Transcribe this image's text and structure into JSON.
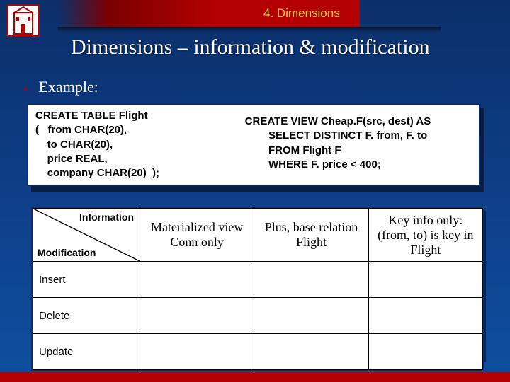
{
  "header": {
    "breadcrumb": "4. Dimensions",
    "title": "Dimensions – information & modification"
  },
  "bullet": {
    "marker": "➢",
    "label": "Example:"
  },
  "code": {
    "left": "CREATE TABLE Flight\n(   from CHAR(20),\n    to CHAR(20),\n    price REAL,\n    company CHAR(20)  );",
    "right": "CREATE VIEW Cheap.F(src, dest) AS\n        SELECT DISTINCT F. from, F. to\n        FROM Flight F\n        WHERE F. price < 400;"
  },
  "table": {
    "diag": {
      "info": "Information",
      "mod": "Modification"
    },
    "cols": [
      "Materialized view Conn only",
      "Plus, base relation Flight",
      "Key info only: (from, to) is key in Flight"
    ],
    "rows": [
      "Insert",
      "Delete",
      "Update"
    ]
  },
  "icon": {
    "logo": "building-logo-icon"
  }
}
